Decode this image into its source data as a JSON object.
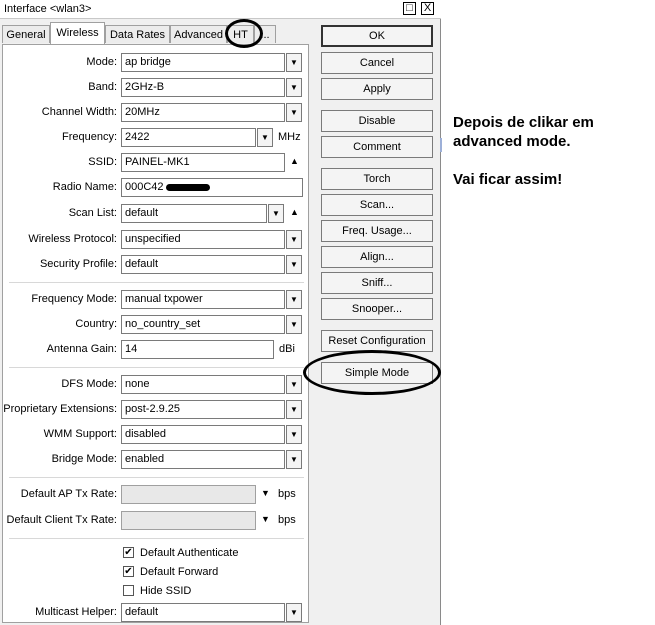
{
  "window": {
    "title": "Interface <wlan3>",
    "restore_glyph": "□",
    "close_glyph": "X"
  },
  "tabs": [
    {
      "label": "General"
    },
    {
      "label": "Wireless"
    },
    {
      "label": "Data Rates"
    },
    {
      "label": "Advanced"
    },
    {
      "label": "HT"
    },
    {
      "label": "..."
    }
  ],
  "form": {
    "mode": {
      "label": "Mode:",
      "value": "ap bridge"
    },
    "band": {
      "label": "Band:",
      "value": "2GHz-B"
    },
    "channel_width": {
      "label": "Channel Width:",
      "value": "20MHz"
    },
    "frequency": {
      "label": "Frequency:",
      "value": "2422",
      "unit": "MHz"
    },
    "ssid": {
      "label": "SSID:",
      "value": "PAINEL-MK1"
    },
    "radio_name": {
      "label": "Radio Name:",
      "value": "000C42"
    },
    "scan_list": {
      "label": "Scan List:",
      "value": "default"
    },
    "wireless_protocol": {
      "label": "Wireless Protocol:",
      "value": "unspecified"
    },
    "security_profile": {
      "label": "Security Profile:",
      "value": "default"
    },
    "frequency_mode": {
      "label": "Frequency Mode:",
      "value": "manual txpower"
    },
    "country": {
      "label": "Country:",
      "value": "no_country_set"
    },
    "antenna_gain": {
      "label": "Antenna Gain:",
      "value": "14",
      "unit": "dBi"
    },
    "dfs_mode": {
      "label": "DFS Mode:",
      "value": "none"
    },
    "proprietary_extensions": {
      "label": "Proprietary Extensions:",
      "value": "post-2.9.25"
    },
    "wmm_support": {
      "label": "WMM Support:",
      "value": "disabled"
    },
    "bridge_mode": {
      "label": "Bridge Mode:",
      "value": "enabled"
    },
    "default_ap_tx_rate": {
      "label": "Default AP Tx Rate:",
      "value": "",
      "unit": "bps"
    },
    "default_client_tx_rate": {
      "label": "Default Client Tx Rate:",
      "value": "",
      "unit": "bps"
    },
    "default_authenticate": {
      "label": "Default Authenticate",
      "checked": true
    },
    "default_forward": {
      "label": "Default Forward",
      "checked": true
    },
    "hide_ssid": {
      "label": "Hide SSID",
      "checked": false
    },
    "multicast_helper": {
      "label": "Multicast Helper:",
      "value": "default"
    }
  },
  "glyphs": {
    "checked": "✔",
    "unchecked": "",
    "down": "▼",
    "up": "▲"
  },
  "buttons": {
    "ok": "OK",
    "cancel": "Cancel",
    "apply": "Apply",
    "disable": "Disable",
    "comment": "Comment",
    "torch": "Torch",
    "scan": "Scan...",
    "freq_usage": "Freq. Usage...",
    "align": "Align...",
    "sniff": "Sniff...",
    "snooper": "Snooper...",
    "reset_configuration": "Reset Configuration",
    "simple_mode": "Simple Mode"
  },
  "annotation": {
    "line1": "Depois de clikar em",
    "line2": "advanced mode.",
    "line3": "Vai ficar assim!"
  }
}
